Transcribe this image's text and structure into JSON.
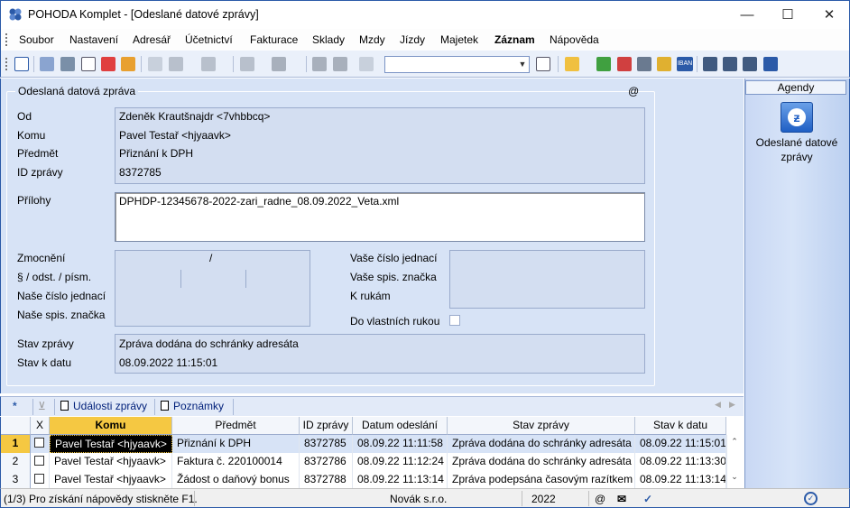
{
  "window": {
    "title": "POHODA Komplet - [Odeslané datové zprávy]",
    "min": "—",
    "max": "☐",
    "close": "✕"
  },
  "menu": [
    "Soubor",
    "Nastavení",
    "Adresář",
    "Účetnictví",
    "Fakturace",
    "Sklady",
    "Mzdy",
    "Jízdy",
    "Majetek",
    "Záznam",
    "Nápověda"
  ],
  "form": {
    "legend": "Odeslaná datová zpráva",
    "at": "@",
    "od_label": "Od",
    "od_value": "Zdeněk Krautšnajdr <7vhbbcq>",
    "komu_label": "Komu",
    "komu_value": "Pavel Testař <hjyaavk>",
    "predmet_label": "Předmět",
    "predmet_value": "Přiznání k DPH",
    "id_label": "ID zprávy",
    "id_value": "8372785",
    "prilohy_label": "Přílohy",
    "prilohy_value": "DPHDP-12345678-2022-zari_radne_08.09.2022_Veta.xml",
    "zmocneni_label": "Zmocnění",
    "zmocneni_value": "/",
    "odst_label": "§ / odst. / písm.",
    "nase_cj_label": "Naše číslo jednací",
    "nase_sz_label": "Naše spis. značka",
    "vase_cj_label": "Vaše číslo jednací",
    "vase_sz_label": "Vaše spis. značka",
    "k_rukam_label": "K rukám",
    "do_vlastnich_label": "Do vlastních rukou",
    "stav_label": "Stav zprávy",
    "stav_value": "Zpráva dodána do schránky adresáta",
    "stav_k_datu_label": "Stav k datu",
    "stav_k_datu_value": "08.09.2022 11:15:01"
  },
  "agendy": {
    "title": "Agendy",
    "item": "Odeslané datové zprávy"
  },
  "tabs": {
    "star": "*",
    "udalosti": "Události zprávy",
    "poznamky": "Poznámky"
  },
  "grid": {
    "headers": {
      "x": "X",
      "komu": "Komu",
      "predmet": "Předmět",
      "id": "ID zprávy",
      "datum": "Datum odeslání",
      "stav": "Stav zprávy",
      "stavk": "Stav k datu"
    },
    "rows": [
      {
        "n": "1",
        "komu": "Pavel Testař <hjyaavk>",
        "predmet": "Přiznání k DPH",
        "id": "8372785",
        "datum": "08.09.22 11:11:58",
        "stav": "Zpráva dodána do schránky adresáta",
        "stavk": "08.09.22 11:15:01"
      },
      {
        "n": "2",
        "komu": "Pavel Testař <hjyaavk>",
        "predmet": "Faktura č. 220100014",
        "id": "8372786",
        "datum": "08.09.22 11:12:24",
        "stav": "Zpráva dodána do schránky adresáta",
        "stavk": "08.09.22 11:13:30"
      },
      {
        "n": "3",
        "komu": "Pavel Testař <hjyaavk>",
        "predmet": "Žádost o daňový bonus",
        "id": "8372788",
        "datum": "08.09.22 11:13:14",
        "stav": "Zpráva podepsána časovým razítkem",
        "stavk": "08.09.22 11:13:14"
      }
    ]
  },
  "status": {
    "help": "(1/3) Pro získání nápovědy stiskněte F1.",
    "company": "Novák s.r.o.",
    "year": "2022",
    "at": "@"
  },
  "colors": {
    "accent": "#2b5aa8",
    "panel": "#d7e3f6",
    "selected_header": "#f5c842",
    "row_num_selected": "#f5c842"
  }
}
